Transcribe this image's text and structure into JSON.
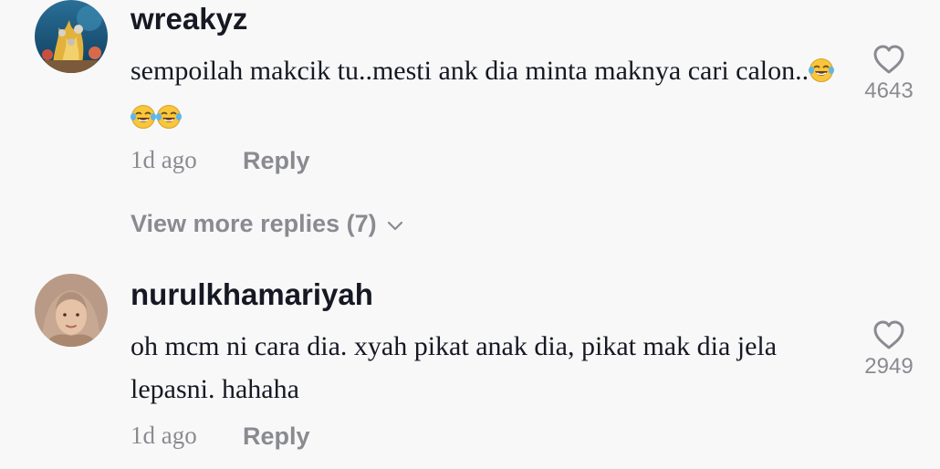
{
  "comments": [
    {
      "username": "wreakyz",
      "text": "sempoilah makcik tu..mesti ank dia minta maknya cari calon..",
      "emoji_count": 3,
      "emoji_icon": "face-with-tears-of-joy-icon",
      "time": "1d ago",
      "reply_label": "Reply",
      "likes": "4643",
      "view_more_label": "View more replies (7)"
    },
    {
      "username": "nurulkhamariyah",
      "text": "oh mcm ni cara dia. xyah pikat anak dia, pikat mak dia jela lepasni. hahaha",
      "time": "1d ago",
      "reply_label": "Reply",
      "likes": "2949"
    }
  ],
  "colors": {
    "background": "#f8f8f8",
    "text_primary": "#161823",
    "text_secondary": "#8a8b91"
  }
}
